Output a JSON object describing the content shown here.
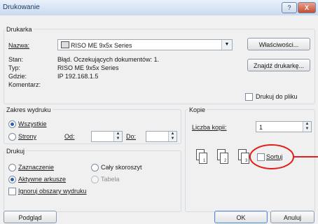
{
  "window": {
    "title": "Drukowanie",
    "help_glyph": "?",
    "close_glyph": "X"
  },
  "printer": {
    "group_label": "Drukarka",
    "name_label": "Nazwa:",
    "name_value": "RISO ME 9x5x Series",
    "status_label": "Stan:",
    "status_value": "Błąd. Oczekujących dokumentów: 1.",
    "type_label": "Typ:",
    "type_value": "RISO ME 9x5x Series",
    "where_label": "Gdzie:",
    "where_value": "IP 192.168.1.5",
    "comment_label": "Komentarz:",
    "properties_button": "Właściwości...",
    "find_button": "Znajdź drukarkę...",
    "print_to_file_label": "Drukuj do pliku"
  },
  "range": {
    "group_label": "Zakres wydruku",
    "all_label": "Wszystkie",
    "pages_label": "Strony",
    "from_label": "Od:",
    "to_label": "Do:"
  },
  "print_what": {
    "group_label": "Drukuj",
    "selection_label": "Zaznaczenie",
    "whole_workbook_label": "Cały skoroszyt",
    "active_sheets_label": "Aktywne arkusze",
    "table_label": "Tabela",
    "ignore_areas_label": "Ignoruj obszary wydruku"
  },
  "copies": {
    "group_label": "Kopie",
    "count_label": "Liczba kopii:",
    "count_value": "1",
    "collate_label": "Sortuj",
    "page_numbers": [
      "1",
      "2",
      "3"
    ]
  },
  "footer": {
    "preview_button": "Podgląd",
    "ok_button": "OK",
    "cancel_button": "Anuluj"
  },
  "colors": {
    "annotation": "#e0201b",
    "title_gradient_start": "#e9f1fb"
  }
}
